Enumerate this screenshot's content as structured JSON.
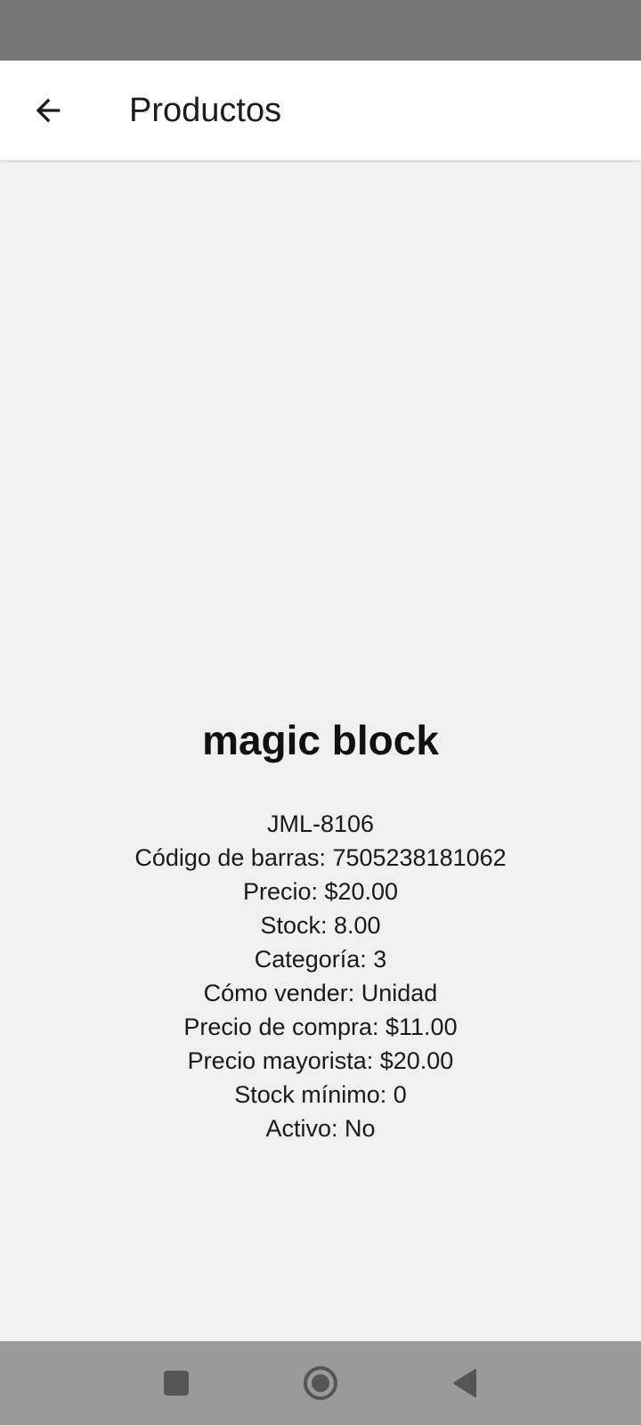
{
  "app_bar": {
    "title": "Productos",
    "back_icon": "arrow-back-icon"
  },
  "product": {
    "name": "magic block",
    "details": [
      "JML-8106",
      "Código de barras: 7505238181062",
      "Precio: $20.00",
      "Stock: 8.00",
      "Categoría: 3",
      "Cómo vender: Unidad",
      "Precio de compra: $11.00",
      "Precio mayorista: $20.00",
      "Stock mínimo: 0",
      "Activo: No"
    ]
  },
  "nav_bar": {
    "recents_icon": "square-icon",
    "home_icon": "circle-home-icon",
    "back_icon": "triangle-back-icon"
  },
  "colors": {
    "status_bar": "#777777",
    "app_bar": "#ffffff",
    "background": "#f0f0f0",
    "nav_bar": "#9a9a9a"
  }
}
